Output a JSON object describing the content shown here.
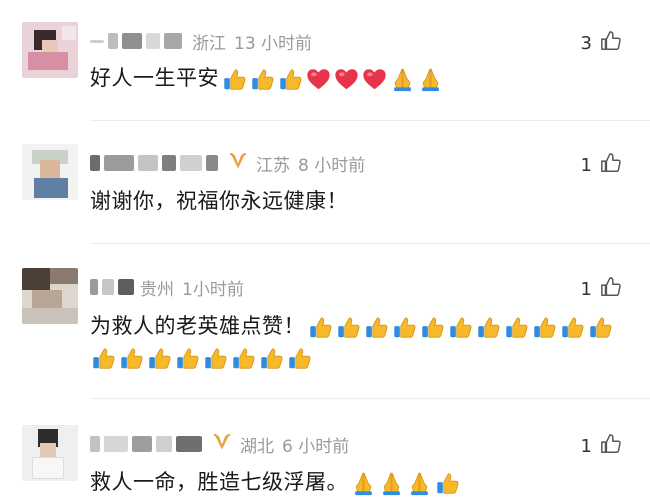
{
  "comments": [
    {
      "location": "浙江",
      "time": "13 小时前",
      "likes": "3",
      "text": "好人一生平安",
      "emojis_line1": [
        "thumbs-up",
        "thumbs-up",
        "thumbs-up",
        "heart",
        "heart",
        "heart",
        "pray",
        "pray"
      ],
      "vip": false
    },
    {
      "location": "江苏",
      "time": "8 小时前",
      "likes": "1",
      "text": "谢谢你，祝福你永远健康！",
      "emojis_line1": [],
      "vip": true
    },
    {
      "location": "贵州",
      "time": "1小时前",
      "likes": "1",
      "text": "为救人的老英雄点赞！",
      "emojis_line1": [
        "thumbs-up",
        "thumbs-up",
        "thumbs-up",
        "thumbs-up",
        "thumbs-up",
        "thumbs-up",
        "thumbs-up",
        "thumbs-up",
        "thumbs-up",
        "thumbs-up",
        "thumbs-up"
      ],
      "emojis_line2": [
        "thumbs-up",
        "thumbs-up",
        "thumbs-up",
        "thumbs-up",
        "thumbs-up",
        "thumbs-up",
        "thumbs-up",
        "thumbs-up"
      ],
      "vip": false
    },
    {
      "location": "湖北",
      "time": "6 小时前",
      "likes": "1",
      "text": "救人一命，胜造七级浮屠。",
      "emojis_line1": [
        "pray",
        "pray",
        "pray",
        "thumbs-up"
      ],
      "vip": true
    }
  ],
  "colors": {
    "meta_gray": "#9a9a9a",
    "text": "#1a1a1a",
    "vip_gold": "#e7a33e",
    "heart": "#e8334a",
    "thumb": "#f5b92a"
  }
}
